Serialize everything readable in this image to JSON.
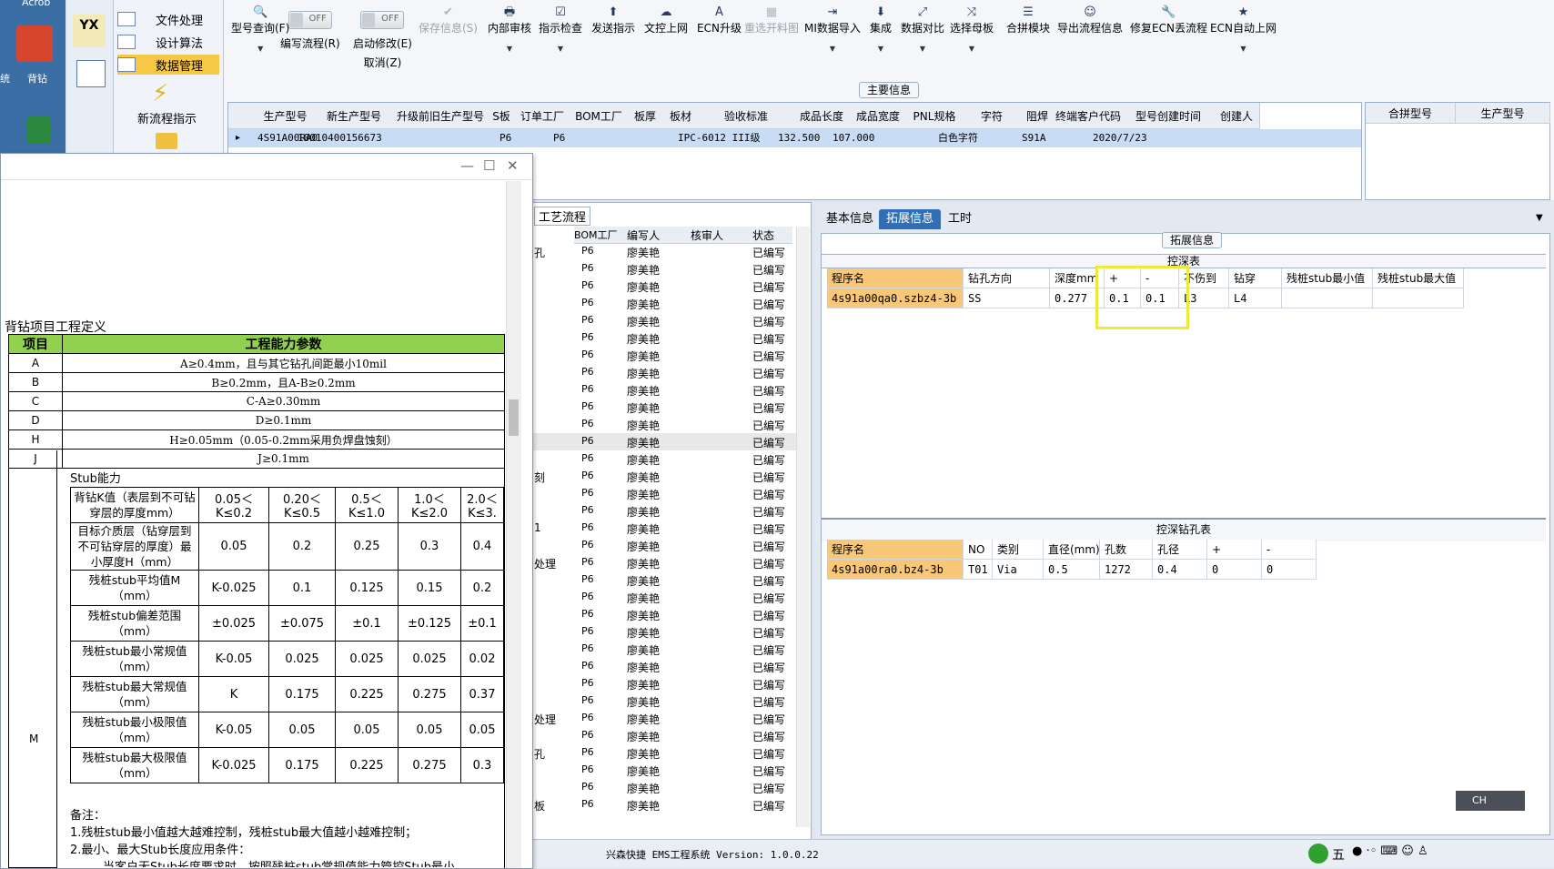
{
  "desktop": {
    "top_label": "Acrob",
    "icons": [
      "背钻",
      "统"
    ]
  },
  "nav": {
    "logo": "YX",
    "items": [
      "文件处理",
      "设计算法",
      "数据管理"
    ],
    "selected": 2,
    "new_flow": "新流程指示"
  },
  "toolbar": [
    {
      "glyph": "🔍",
      "label": "型号查询(F)",
      "dd": true
    },
    {
      "toggle": "OFF",
      "label": "编写流程(R)"
    },
    {
      "toggle": "OFF",
      "label": "启动修改(E)",
      "sub": "取消(Z)"
    },
    {
      "glyph": "✔",
      "label": "保存信息(S)",
      "disabled": true
    },
    {
      "glyph": "🖶",
      "label": "内部审核",
      "dd": true
    },
    {
      "glyph": "☑",
      "label": "指示检查",
      "dd": true
    },
    {
      "glyph": "⬆",
      "label": "发送指示"
    },
    {
      "glyph": "☁",
      "label": "文控上网"
    },
    {
      "glyph": "A",
      "label": "ECN升级"
    },
    {
      "glyph": "▦",
      "label": "重选开料图",
      "disabled": true
    },
    {
      "glyph": "⇥",
      "label": "MI数据导入",
      "dd": true
    },
    {
      "glyph": "⬇",
      "label": "集成",
      "dd": true
    },
    {
      "glyph": "⤢",
      "label": "数据对比",
      "dd": true
    },
    {
      "glyph": "⤨",
      "label": "选择母板",
      "dd": true
    },
    {
      "glyph": "☰",
      "label": "合拼模块"
    },
    {
      "glyph": "☺",
      "label": "导出流程信息"
    },
    {
      "glyph": "🔧",
      "label": "修复ECN丢流程"
    },
    {
      "glyph": "★",
      "label": "ECN自动上网",
      "dd": true
    }
  ],
  "main": {
    "title": "主要信息",
    "headers": [
      "生产型号",
      "新生产型号",
      "升级前旧生产型号",
      "S板",
      "订单工厂",
      "BOM工厂",
      "板厚",
      "板材",
      "验收标准",
      "成品长度",
      "成品宽度",
      "PNL规格",
      "字符",
      "阻焊",
      "终端客户代码",
      "型号创建时间",
      "创建人"
    ],
    "row": {
      "prod": "4S91A00RA0",
      "newprod": "10010400156673",
      "order": "P6",
      "bom": "P6",
      "std": "IPC-6012 III级",
      "len": "132.500",
      "wid": "107.000",
      "char": "白色字符",
      "cust": "S91A",
      "time": "2020/7/23"
    },
    "merge_headers": [
      "合拼型号",
      "生产型号"
    ]
  },
  "process": {
    "title": "工艺流程",
    "headers": [
      "BOM工厂",
      "编写人",
      "核审人",
      "状态"
    ],
    "factory": "P6",
    "writer": "廖美艳",
    "status": "已编写",
    "left_fragments": {
      "0": "孔",
      "13": "刻",
      "16": "1",
      "18": "处理",
      "27": "处理",
      "29": "孔",
      "32": "板"
    },
    "rows": 33
  },
  "right": {
    "tabs": [
      "基本信息",
      "拓展信息",
      "工时"
    ],
    "active": 1,
    "group": "拓展信息",
    "t1": {
      "title": "控深表",
      "headers": [
        "程序名",
        "钻孔方向",
        "深度mm",
        "+",
        "-",
        "不伤到",
        "钻穿",
        "残桩stub最小值",
        "残桩stub最大值"
      ],
      "row": [
        "4s91a00qa0.szbz4-3b",
        "SS",
        "0.277",
        "0.1",
        "0.1",
        "L3",
        "L4",
        "",
        ""
      ]
    },
    "t2": {
      "title": "控深钻孔表",
      "headers": [
        "程序名",
        "NO",
        "类别",
        "直径(mm)",
        "孔数",
        "孔径",
        "+",
        "-"
      ],
      "row": [
        "4s91a00ra0.bz4-3b",
        "T01",
        "Via",
        "0.5",
        "1272",
        "0.4",
        "0",
        "0"
      ]
    }
  },
  "statusbar": {
    "text": "兴森快捷 EMS工程系统 Version: 1.0.0.22",
    "ime": "CH",
    "tray": "五"
  },
  "doc": {
    "heading": "背钻项目工程定义",
    "col1": "项目",
    "col2": "工程能力参数",
    "rows": [
      [
        "A",
        "A≥0.4mm，且与其它钻孔间距最小10mil"
      ],
      [
        "B",
        "B≥0.2mm，且A-B≥0.2mm"
      ],
      [
        "C",
        "C-A≥0.30mm"
      ],
      [
        "D",
        "D≥0.1mm"
      ],
      [
        "H",
        "H≥0.05mm（0.05-0.2mm采用负焊盘蚀刻）"
      ],
      [
        "J",
        "J≥0.1mm"
      ]
    ],
    "m_label": "M",
    "stub_title": "Stub能力",
    "stub": [
      [
        "背钻K值（表层到不可钻穿层的厚度mm）",
        "0.05＜K≤0.2",
        "0.20＜K≤0.5",
        "0.5＜K≤1.0",
        "1.0＜K≤2.0",
        "2.0＜K≤3."
      ],
      [
        "目标介质层（钻穿层到不可钻穿层的厚度）最小厚度H（mm）",
        "0.05",
        "0.2",
        "0.25",
        "0.3",
        "0.4"
      ],
      [
        "残桩stub平均值M（mm）",
        "K-0.025",
        "0.1",
        "0.125",
        "0.15",
        "0.2"
      ],
      [
        "残桩stub偏差范围（mm）",
        "±0.025",
        "±0.075",
        "±0.1",
        "±0.125",
        "±0.1"
      ],
      [
        "残桩stub最小常规值（mm）",
        "K-0.05",
        "0.025",
        "0.025",
        "0.025",
        "0.02"
      ],
      [
        "残桩stub最大常规值（mm）",
        "K",
        "0.175",
        "0.225",
        "0.275",
        "0.37"
      ],
      [
        "残桩stub最小极限值（mm）",
        "K-0.05",
        "0.05",
        "0.05",
        "0.05",
        "0.05"
      ],
      [
        "残桩stub最大极限值（mm）",
        "K-0.025",
        "0.175",
        "0.225",
        "0.275",
        "0.3"
      ]
    ],
    "notes": [
      "备注：",
      "1.残桩stub最小值越大越难控制，残桩stub最大值越小越难控制；",
      "2.最小、最大Stub长度应用条件："
    ],
    "note_cut": "当客户无Stub长度要求时，按照残桩stub常规值能力管控Stub最小"
  }
}
